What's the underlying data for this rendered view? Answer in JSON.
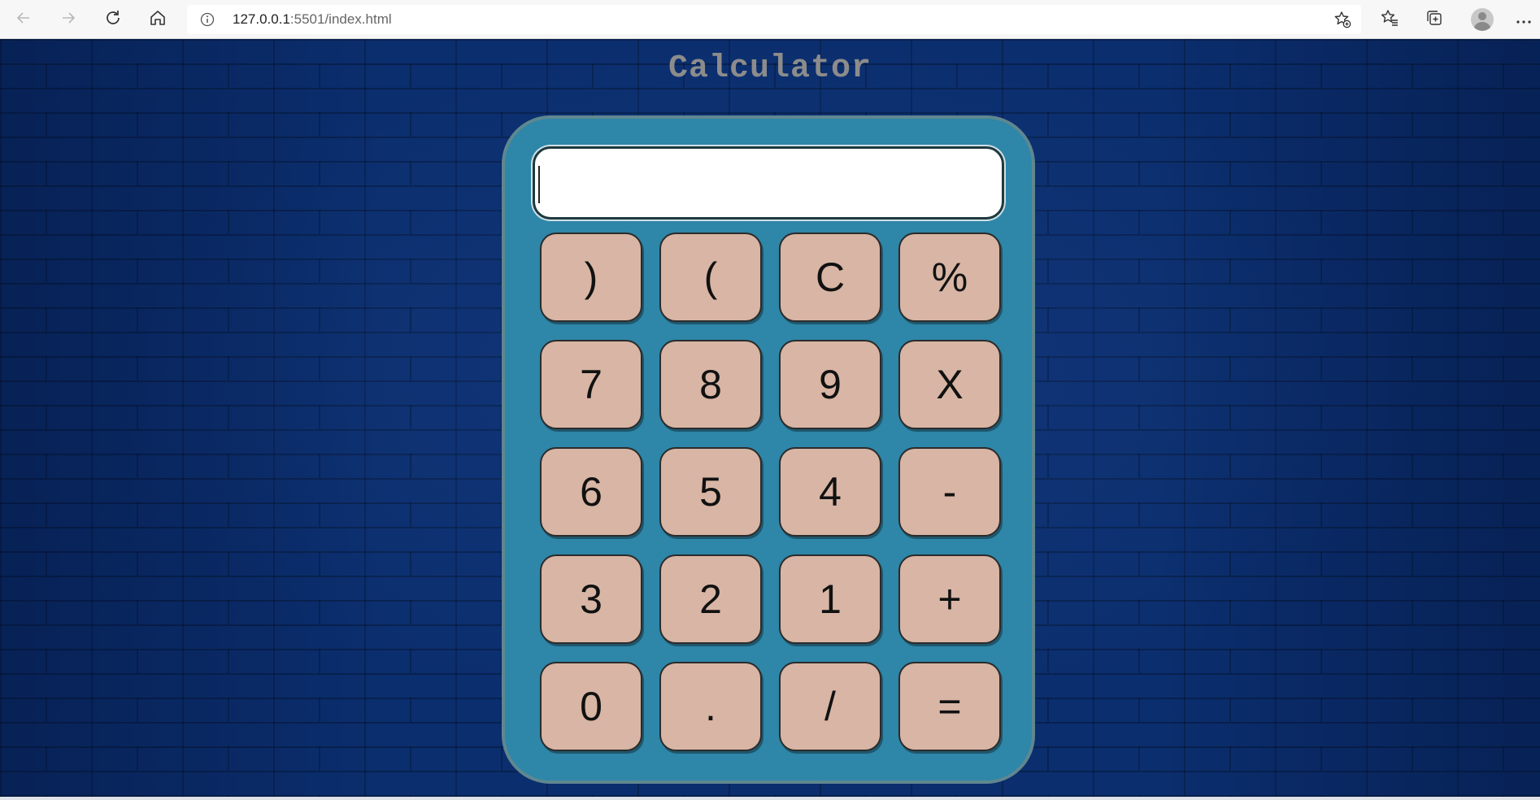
{
  "browser": {
    "url_host": "127.0.0.1",
    "url_rest": ":5501/index.html",
    "icons": {
      "back": "arrow-left-icon",
      "forward": "arrow-right-icon",
      "reload": "reload-icon",
      "home": "home-icon",
      "info": "info-icon",
      "add_favorite": "star-plus-icon",
      "favorites": "favorites-icon",
      "collections": "collections-icon",
      "profile": "profile-icon",
      "menu": "more-icon"
    }
  },
  "page": {
    "title": "Calculator",
    "display_value": "",
    "colors": {
      "background": "#0b2e6e",
      "calculator_body": "#2e86a8",
      "key": "#d8b5a4",
      "title": "#8c8c8c"
    }
  },
  "keys": [
    {
      "label": ")"
    },
    {
      "label": "("
    },
    {
      "label": "C"
    },
    {
      "label": "%"
    },
    {
      "label": "7"
    },
    {
      "label": "8"
    },
    {
      "label": "9"
    },
    {
      "label": "X"
    },
    {
      "label": "6"
    },
    {
      "label": "5"
    },
    {
      "label": "4"
    },
    {
      "label": "-"
    },
    {
      "label": "3"
    },
    {
      "label": "2"
    },
    {
      "label": "1"
    },
    {
      "label": "+"
    },
    {
      "label": "0"
    },
    {
      "label": "."
    },
    {
      "label": "/"
    },
    {
      "label": "="
    }
  ]
}
